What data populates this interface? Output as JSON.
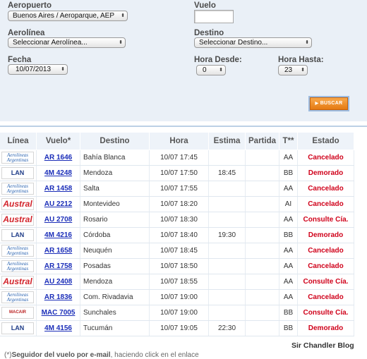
{
  "form": {
    "aeropuerto_label": "Aeropuerto",
    "aeropuerto_value": "Buenos Aires / Aeroparque, AEP",
    "vuelo_label": "Vuelo",
    "vuelo_value": "",
    "aerolinea_label": "Aerolínea",
    "aerolinea_value": "Seleccionar Aerolínea...",
    "destino_label": "Destino",
    "destino_value": "Seleccionar Destino...",
    "fecha_label": "Fecha",
    "fecha_value": "10/07/2013",
    "hora_desde_label": "Hora Desde:",
    "hora_desde_value": "0",
    "hora_hasta_label": "Hora Hasta:",
    "hora_hasta_value": "23",
    "search_label": "BUSCAR"
  },
  "table": {
    "headers": [
      "Línea",
      "Vuelo*",
      "Destino",
      "Hora",
      "Estima",
      "Partida",
      "T**",
      "Estado"
    ],
    "rows": [
      {
        "airline": "Aerolíneas Argentinas",
        "logo": "aa",
        "flight": "AR 1646",
        "dest": "Bahía Blanca",
        "time": "10/07 17:45",
        "est": "",
        "dep": "",
        "term": "AA",
        "status": "Cancelado"
      },
      {
        "airline": "LAN",
        "logo": "lan",
        "flight": "4M 4248",
        "dest": "Mendoza",
        "time": "10/07 17:50",
        "est": "18:45",
        "dep": "",
        "term": "BB",
        "status": "Demorado"
      },
      {
        "airline": "Aerolíneas Argentinas",
        "logo": "aa",
        "flight": "AR 1458",
        "dest": "Salta",
        "time": "10/07 17:55",
        "est": "",
        "dep": "",
        "term": "AA",
        "status": "Cancelado"
      },
      {
        "airline": "Austral",
        "logo": "austral",
        "flight": "AU 2212",
        "dest": "Montevideo",
        "time": "10/07 18:20",
        "est": "",
        "dep": "",
        "term": "AI",
        "status": "Cancelado"
      },
      {
        "airline": "Austral",
        "logo": "austral",
        "flight": "AU 2708",
        "dest": "Rosario",
        "time": "10/07 18:30",
        "est": "",
        "dep": "",
        "term": "AA",
        "status": "Consulte Cía."
      },
      {
        "airline": "LAN",
        "logo": "lan",
        "flight": "4M 4216",
        "dest": "Córdoba",
        "time": "10/07 18:40",
        "est": "19:30",
        "dep": "",
        "term": "BB",
        "status": "Demorado"
      },
      {
        "airline": "Aerolíneas Argentinas",
        "logo": "aa",
        "flight": "AR 1658",
        "dest": "Neuquén",
        "time": "10/07 18:45",
        "est": "",
        "dep": "",
        "term": "AA",
        "status": "Cancelado"
      },
      {
        "airline": "Aerolíneas Argentinas",
        "logo": "aa",
        "flight": "AR 1758",
        "dest": "Posadas",
        "time": "10/07 18:50",
        "est": "",
        "dep": "",
        "term": "AA",
        "status": "Cancelado"
      },
      {
        "airline": "Austral",
        "logo": "austral",
        "flight": "AU 2408",
        "dest": "Mendoza",
        "time": "10/07 18:55",
        "est": "",
        "dep": "",
        "term": "AA",
        "status": "Consulte Cía."
      },
      {
        "airline": "Aerolíneas Argentinas",
        "logo": "aa",
        "flight": "AR 1836",
        "dest": "Com. Rivadavia",
        "time": "10/07 19:00",
        "est": "",
        "dep": "",
        "term": "AA",
        "status": "Cancelado"
      },
      {
        "airline": "MACAIR",
        "logo": "mac",
        "flight": "MAC 7005",
        "dest": "Sunchales",
        "time": "10/07 19:00",
        "est": "",
        "dep": "",
        "term": "BB",
        "status": "Consulte Cía."
      },
      {
        "airline": "LAN",
        "logo": "lan",
        "flight": "4M 4156",
        "dest": "Tucumán",
        "time": "10/07 19:05",
        "est": "22:30",
        "dep": "",
        "term": "BB",
        "status": "Demorado"
      }
    ]
  },
  "logos": {
    "aa_line1": "Aerolíneas",
    "aa_line2": "Argentinas",
    "lan": "LAN",
    "austral": "Austral",
    "mac": "MACAIR"
  },
  "colors": {
    "status_red": "#d0021b",
    "link_blue": "#1a2db8",
    "search_orange": "#f08a1c"
  },
  "watermark": "Sir Chandler Blog",
  "footnote": {
    "prefix": "(*)",
    "bold": "Seguidor del vuelo por e-mail",
    "rest": ", haciendo click en el enlace"
  }
}
